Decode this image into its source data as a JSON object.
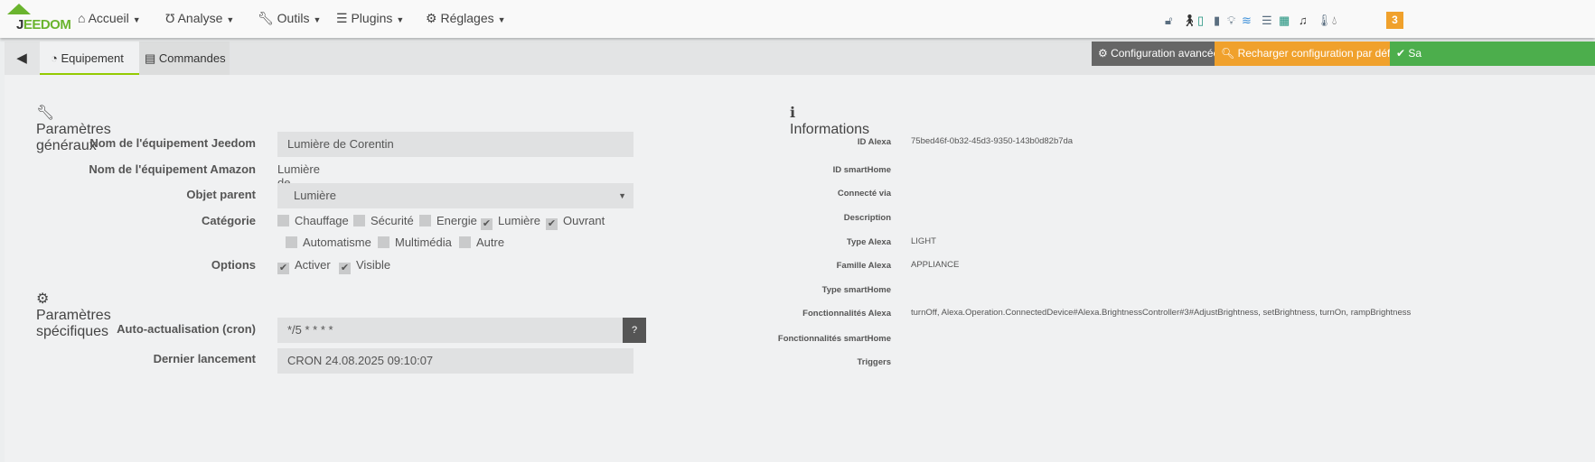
{
  "nav": {
    "logo_text": "JEEDOM",
    "menus": [
      {
        "label": "Accueil",
        "icon": "home-icon"
      },
      {
        "label": "Analyse",
        "icon": "stethoscope-icon"
      },
      {
        "label": "Outils",
        "icon": "wrench-icon"
      },
      {
        "label": "Plugins",
        "icon": "list-check-icon"
      },
      {
        "label": "Réglages",
        "icon": "gear-icon"
      }
    ],
    "status_icons": [
      "unlock-icon",
      "walking-icon",
      "window-icon",
      "door-icon",
      "lightbulb-icon",
      "pool-icon",
      "air-conditioner-icon",
      "solar-panel-icon",
      "music-icon",
      "thermometer-icon",
      "water-drop-icon"
    ],
    "notification_count": "3"
  },
  "tabs": {
    "back": "back-icon",
    "equipement": "Equipement",
    "commandes": "Commandes"
  },
  "toolbar": {
    "advanced": "Configuration avancée",
    "reload": "Recharger configuration par défaut",
    "save": "Sa",
    "colors": {
      "advanced": "#666666",
      "reload": "#f0a12c",
      "save": "#4cae4c"
    }
  },
  "general": {
    "title": "Paramètres généraux",
    "jeedom_name_label": "Nom de l'équipement Jeedom",
    "jeedom_name_value": "Lumière de Corentin",
    "amazon_name_label": "Nom de l'équipement Amazon",
    "amazon_name_value": "Lumière de Corentin",
    "parent_label": "Objet parent",
    "parent_value": "Lumière",
    "category_label": "Catégorie",
    "categories": [
      {
        "label": "Chauffage",
        "checked": false
      },
      {
        "label": "Sécurité",
        "checked": false
      },
      {
        "label": "Energie",
        "checked": false
      },
      {
        "label": "Lumière",
        "checked": true
      },
      {
        "label": "Ouvrant",
        "checked": true
      },
      {
        "label": "Automatisme",
        "checked": false
      },
      {
        "label": "Multimédia",
        "checked": false
      },
      {
        "label": "Autre",
        "checked": false
      }
    ],
    "options_label": "Options",
    "options": [
      {
        "label": "Activer",
        "checked": true
      },
      {
        "label": "Visible",
        "checked": true
      }
    ]
  },
  "specific": {
    "title": "Paramètres spécifiques",
    "cron_label": "Auto-actualisation (cron)",
    "cron_value": "*/5 * * * *",
    "last_label": "Dernier lancement",
    "last_value": "CRON 24.08.2025 09:10:07"
  },
  "info": {
    "title": "Informations",
    "rows": [
      {
        "label": "ID Alexa",
        "value": "75bed46f-0b32-45d3-9350-143b0d82b7da"
      },
      {
        "label": "ID smartHome",
        "value": ""
      },
      {
        "label": "Connecté via",
        "value": ""
      },
      {
        "label": "Description",
        "value": ""
      },
      {
        "label": "Type Alexa",
        "value": "LIGHT"
      },
      {
        "label": "Famille Alexa",
        "value": "APPLIANCE"
      },
      {
        "label": "Type smartHome",
        "value": ""
      },
      {
        "label": "Fonctionnalités Alexa",
        "value": "turnOff, Alexa.Operation.ConnectedDevice#Alexa.BrightnessController#3#AdjustBrightness, setBrightness, turnOn, rampBrightness"
      },
      {
        "label": "Fonctionnalités smartHome",
        "value": ""
      },
      {
        "label": "Triggers",
        "value": ""
      }
    ]
  }
}
